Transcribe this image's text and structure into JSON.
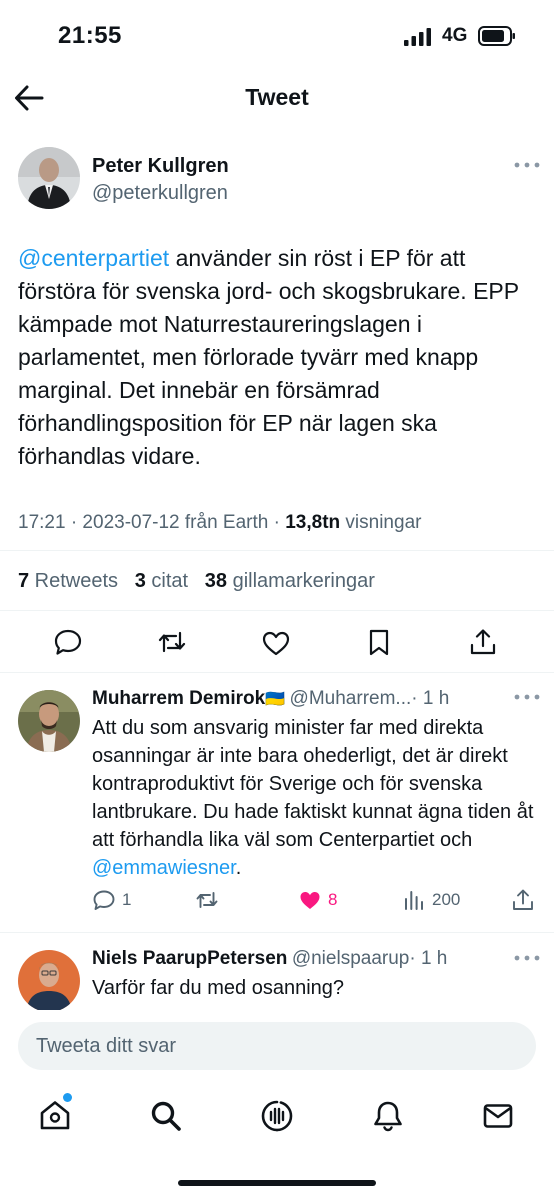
{
  "status_bar": {
    "time": "21:55",
    "network": "4G"
  },
  "header": {
    "title": "Tweet"
  },
  "tweet": {
    "author_name": "Peter Kullgren",
    "author_handle": "@peterkullgren",
    "mention": "@centerpartiet",
    "text": " använder sin röst i EP för att förstöra för svenska jord- och skogsbrukare. EPP kämpade mot Naturrestaureringslagen i parlamentet, men förlorade tyvärr med knapp marginal. Det innebär en försämrad förhandlingsposition för EP när lagen ska förhandlas vidare.",
    "timestamp": "17:21 · 2023-07-12 från Earth · ",
    "views_count": "13,8tn",
    "views_label": " visningar",
    "retweets_count": "7",
    "retweets_label": " Retweets",
    "quotes_count": "3",
    "quotes_label": " citat",
    "likes_count": "38",
    "likes_label": " gillamarkeringar"
  },
  "replies": [
    {
      "name": "Muharrem Demirok",
      "flag": "🇺🇦",
      "handle": "@Muharrem...",
      "time": "· 1 h",
      "text": "Att du som ansvarig minister far med direkta osanningar är inte bara ohederligt, det är direkt kontraproduktivt för Sverige och för svenska lantbrukare. Du hade faktiskt kunnat ägna tiden åt att förhandla lika väl som Centerpartiet och ",
      "mention": "@emmawiesner",
      "tail": ".",
      "reply_count": "1",
      "like_count": "8",
      "view_count": "200"
    },
    {
      "name": "Niels PaarupPetersen",
      "handle": "@nielspaarup",
      "time": "· 1 h",
      "text": "Varför far du med osanning?"
    }
  ],
  "composer": {
    "placeholder": "Tweeta ditt svar"
  },
  "colors": {
    "accent": "#1d9bf0",
    "like": "#f91880",
    "text": "#0f1419",
    "muted": "#536471"
  },
  "icons": [
    "back-arrow-icon",
    "more-icon",
    "reply-icon",
    "retweet-icon",
    "like-icon",
    "bookmark-icon",
    "share-icon",
    "views-icon",
    "home-icon",
    "search-icon",
    "spaces-icon",
    "notifications-icon",
    "messages-icon"
  ]
}
